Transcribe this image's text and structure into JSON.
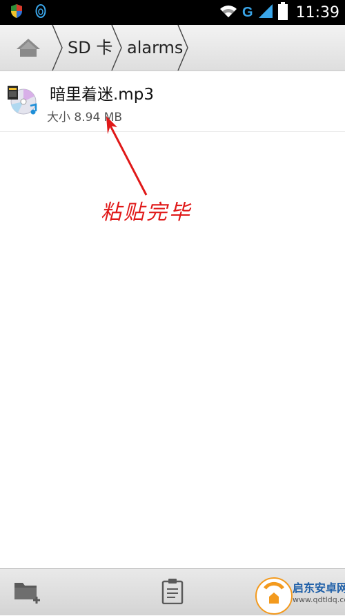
{
  "status_bar": {
    "network_type": "G",
    "time": "11:39",
    "icons": [
      "shield-icon",
      "qq-penguin-icon",
      "wifi-icon",
      "signal-icon",
      "battery-icon"
    ]
  },
  "breadcrumb": {
    "home_icon": "home-icon",
    "items": [
      {
        "label": "SD 卡"
      },
      {
        "label": "alarms"
      }
    ]
  },
  "files": [
    {
      "name": "暗里着迷.mp3",
      "size": "大小 8.94 MB",
      "icon": "audio-file-icon"
    }
  ],
  "annotation": {
    "text": "粘贴完毕",
    "color": "#e01818"
  },
  "bottom_bar": {
    "icons": [
      "new-folder-icon",
      "paste-icon"
    ]
  },
  "watermark": {
    "title": "启东安卓网",
    "url": "www.qdtldq.com"
  }
}
